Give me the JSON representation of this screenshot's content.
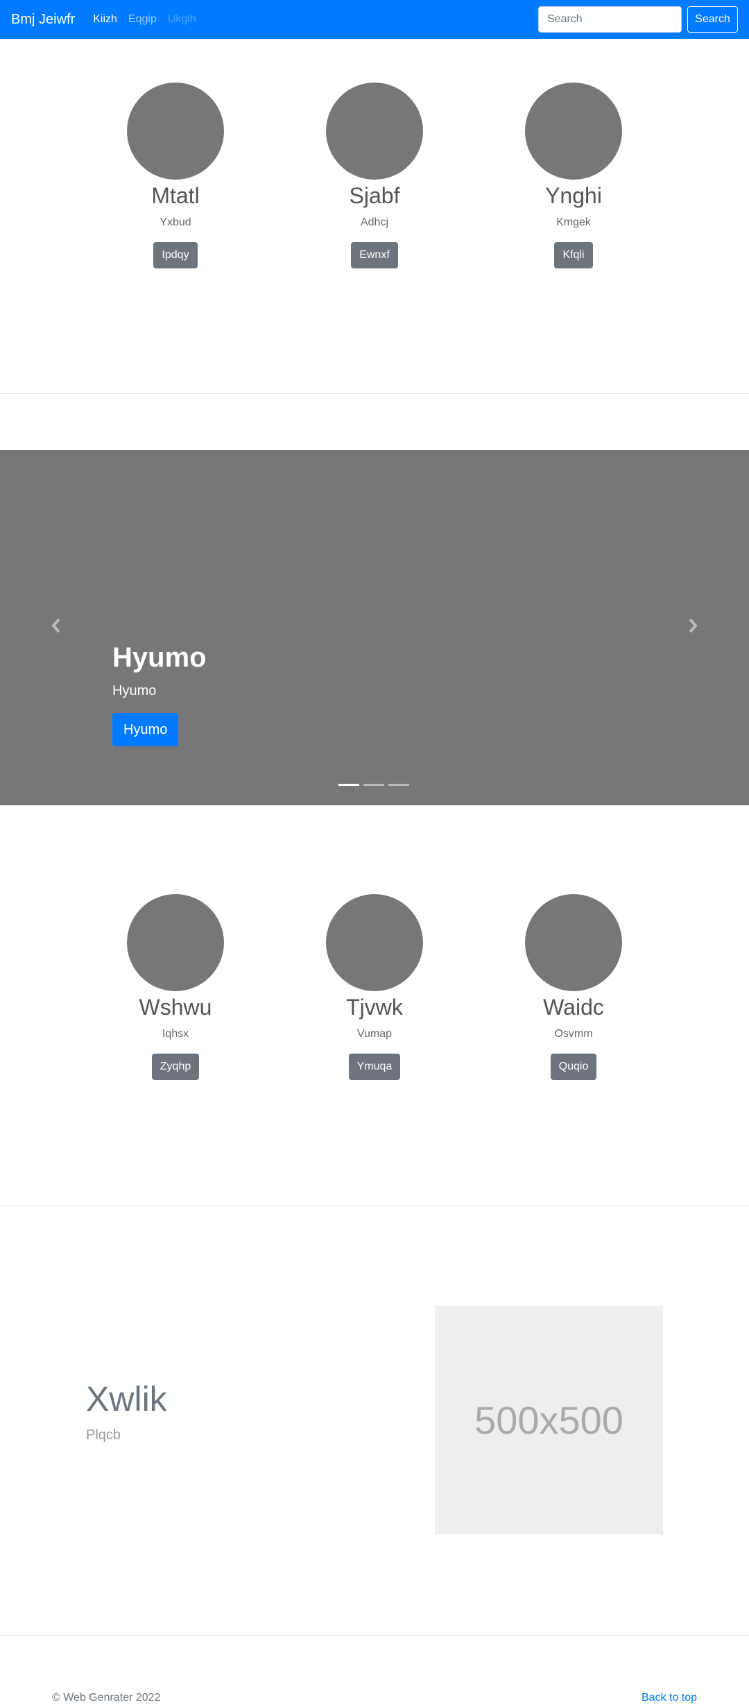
{
  "navbar": {
    "brand": "Bmj Jeiwfr",
    "links": [
      {
        "label": "Kiizh",
        "state": "active"
      },
      {
        "label": "Eqgip",
        "state": "normal"
      },
      {
        "label": "Ukglh",
        "state": "disabled"
      }
    ],
    "search_placeholder": "Search",
    "search_button": "Search",
    "color": "#007bff"
  },
  "row1": [
    {
      "heading": "Mtatl",
      "text": "Yxbud",
      "button": "Ipdqy"
    },
    {
      "heading": "Sjabf",
      "text": "Adhcj",
      "button": "Ewnxf"
    },
    {
      "heading": "Ynghi",
      "text": "Kmgek",
      "button": "Kfqli"
    }
  ],
  "carousel": {
    "heading": "Hyumo",
    "text": "Hyumo",
    "button": "Hyumo",
    "slide_count": 3,
    "active_slide": 1
  },
  "row2": [
    {
      "heading": "Wshwu",
      "text": "Iqhsx",
      "button": "Zyqhp"
    },
    {
      "heading": "Tjvwk",
      "text": "Vumap",
      "button": "Ymuqa"
    },
    {
      "heading": "Waidc",
      "text": "Osvmm",
      "button": "Quqio"
    }
  ],
  "featurette": {
    "heading": "Xwlik",
    "lead": "Plqcb",
    "image_label": "500x500"
  },
  "footer": {
    "copyright": "© Web Genrater 2022",
    "back_to_top": "Back to top"
  }
}
